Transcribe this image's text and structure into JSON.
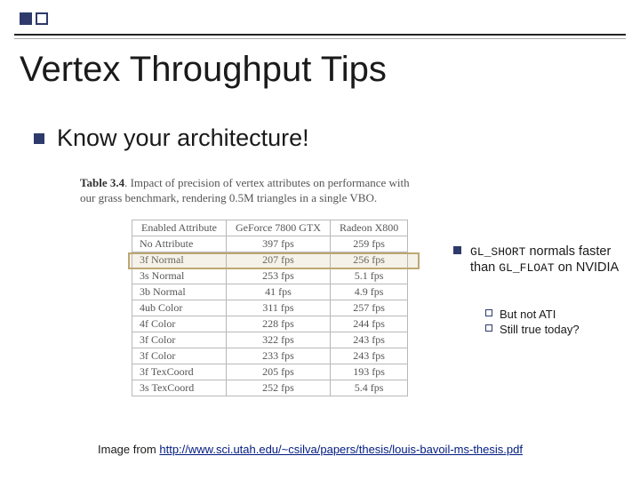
{
  "title": "Vertex Throughput Tips",
  "main_point": "Know your architecture!",
  "table_caption": {
    "prefix": "Table 3.4",
    "text": ". Impact of precision of vertex attributes on performance with our grass benchmark, rendering 0.5M triangles in a single VBO."
  },
  "chart_data": {
    "type": "table",
    "columns": [
      "Enabled Attribute",
      "GeForce 7800 GTX",
      "Radeon X800"
    ],
    "rows": [
      {
        "label": "No Attribute",
        "gf": "397 fps",
        "rx": "259 fps"
      },
      {
        "label": "3f Normal",
        "gf": "207 fps",
        "rx": "256 fps"
      },
      {
        "label": "3s Normal",
        "gf": "253 fps",
        "rx": "5.1 fps"
      },
      {
        "label": "3b Normal",
        "gf": "41 fps",
        "rx": "4.9 fps"
      },
      {
        "label": "4ub Color",
        "gf": "311 fps",
        "rx": "257 fps"
      },
      {
        "label": "4f Color",
        "gf": "228 fps",
        "rx": "244 fps"
      },
      {
        "label": "3f Color",
        "gf": "322 fps",
        "rx": "243 fps"
      },
      {
        "label": "3f Color",
        "gf": "233 fps",
        "rx": "243 fps"
      },
      {
        "label": "3f TexCoord",
        "gf": "205 fps",
        "rx": "193 fps"
      },
      {
        "label": "3s TexCoord",
        "gf": "252 fps",
        "rx": "5.4 fps"
      }
    ],
    "highlighted_row_index": 2
  },
  "note": {
    "code1": "GL_SHORT",
    "mid1": " normals faster than ",
    "code2": "GL_FLOAT",
    "mid2": " on NVIDIA",
    "sub1": "But not ATI",
    "sub2": "Still true today?"
  },
  "credit": {
    "prefix": "Image from ",
    "url_text": "http://www.sci.utah.edu/~csilva/papers/thesis/louis-bavoil-ms-thesis.pdf"
  }
}
